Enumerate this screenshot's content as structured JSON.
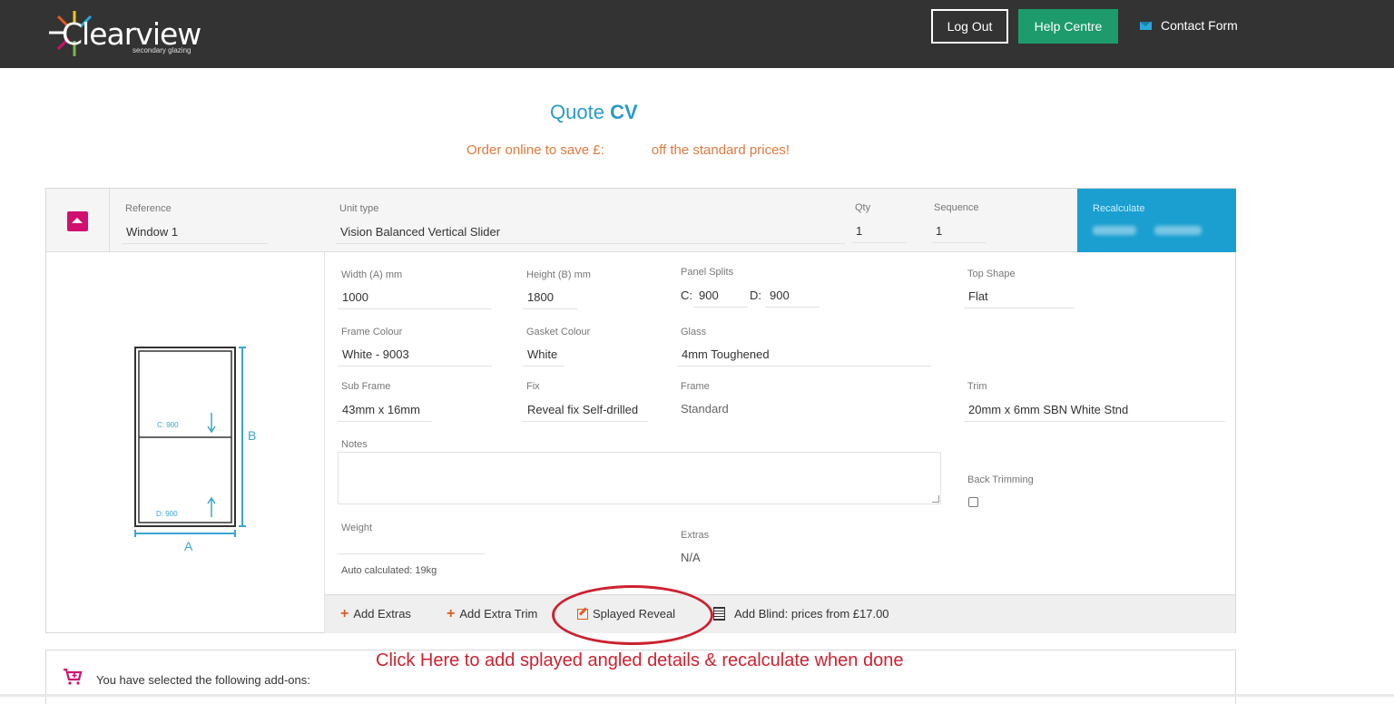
{
  "header": {
    "logo_text": "Clearview",
    "logo_subtext": "secondary glazing",
    "logout_label": "Log Out",
    "help_label": "Help Centre",
    "contact_label": "Contact Form"
  },
  "page": {
    "title_prefix": "Quote",
    "title_code": "CV",
    "promo_left": "Order online to save £:",
    "promo_right": "off the standard prices!"
  },
  "item": {
    "reference_label": "Reference",
    "reference_value": "Window 1",
    "unit_type_label": "Unit type",
    "unit_type_value": "Vision Balanced Vertical Slider",
    "qty_label": "Qty",
    "qty_value": "1",
    "sequence_label": "Sequence",
    "sequence_value": "1",
    "recalculate_label": "Recalculate"
  },
  "diagram": {
    "label_c": "C: 900",
    "label_d": "D: 900",
    "label_a": "A",
    "label_b": "B"
  },
  "form": {
    "width_label": "Width (A) mm",
    "width_value": "1000",
    "height_label": "Height (B) mm",
    "height_value": "1800",
    "panel_splits_label": "Panel Splits",
    "split_c_label": "C:",
    "split_c_value": "900",
    "split_d_label": "D:",
    "split_d_value": "900",
    "top_shape_label": "Top Shape",
    "top_shape_value": "Flat",
    "frame_colour_label": "Frame Colour",
    "frame_colour_value": "White - 9003",
    "gasket_colour_label": "Gasket Colour",
    "gasket_colour_value": "White",
    "glass_label": "Glass",
    "glass_value": "4mm Toughened",
    "sub_frame_label": "Sub Frame",
    "sub_frame_value": "43mm x 16mm",
    "fix_label": "Fix",
    "fix_value": "Reveal fix Self-drilled",
    "frame_label": "Frame",
    "frame_value": "Standard",
    "trim_label": "Trim",
    "trim_value": "20mm x 6mm SBN White Stnd",
    "notes_label": "Notes",
    "back_trimming_label": "Back Trimming",
    "weight_label": "Weight",
    "weight_note": "Auto calculated: 19kg",
    "extras_label": "Extras",
    "extras_value": "N/A"
  },
  "footer": {
    "add_extras": "Add Extras",
    "add_extra_trim": "Add Extra Trim",
    "splayed_reveal": "Splayed Reveal",
    "add_blind": "Add Blind: prices from £17.00"
  },
  "annotation": "Click Here to add splayed angled details & recalculate when done",
  "addons_text": "You have selected the following add-ons:",
  "colors": {
    "topbar": "#333333",
    "help_green": "#1d9b6c",
    "accent_blue": "#1a9fd0",
    "promo_orange": "#e07a3f",
    "collapse_magenta": "#d0106e",
    "annotation_red": "#cc2230"
  }
}
